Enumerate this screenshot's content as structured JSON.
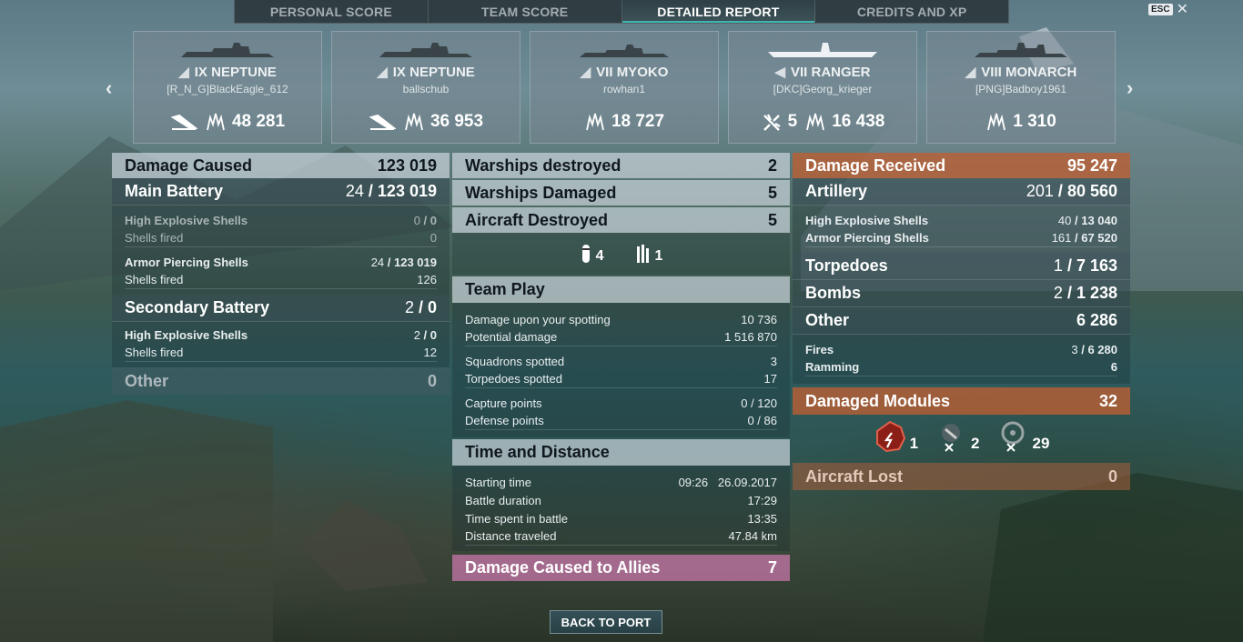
{
  "tabs": [
    {
      "label": "PERSONAL SCORE"
    },
    {
      "label": "TEAM SCORE"
    },
    {
      "label": "DETAILED REPORT"
    },
    {
      "label": "CREDITS AND XP"
    }
  ],
  "esc_label": "ESC",
  "ships": [
    {
      "tier": "IX",
      "name": "NEPTUNE",
      "player": "[R_N_G]BlackEagle_612",
      "kills": null,
      "damage": "48 281",
      "kill_icon": "sunk-ship-icon"
    },
    {
      "tier": "IX",
      "name": "NEPTUNE",
      "player": "ballschub",
      "kills": null,
      "damage": "36 953",
      "kill_icon": "sunk-ship-icon"
    },
    {
      "tier": "VII",
      "name": "MYOKO",
      "player": "rowhan1",
      "kills": null,
      "damage": "18 727"
    },
    {
      "tier": "VII",
      "name": "RANGER",
      "player": "[DKC]Georg_krieger",
      "kills": "5",
      "damage": "16 438",
      "kill_icon": "aircraft-downed-icon"
    },
    {
      "tier": "VIII",
      "name": "MONARCH",
      "player": "[PNG]Badboy1961",
      "kills": null,
      "damage": "1 310"
    }
  ],
  "left": {
    "damage_caused": {
      "label": "Damage Caused",
      "value": "123 019"
    },
    "main_battery": {
      "label": "Main Battery",
      "hits": "24",
      "value": "123 019"
    },
    "he": {
      "label": "High Explosive Shells",
      "hits": "0",
      "value": "0"
    },
    "he_fired": {
      "label": "Shells fired",
      "value": "0"
    },
    "ap": {
      "label": "Armor Piercing Shells",
      "hits": "24",
      "value": "123 019"
    },
    "ap_fired": {
      "label": "Shells fired",
      "value": "126"
    },
    "secondary": {
      "label": "Secondary Battery",
      "hits": "2",
      "value": "0"
    },
    "sec_he": {
      "label": "High Explosive Shells",
      "hits": "2",
      "value": "0"
    },
    "sec_fired": {
      "label": "Shells fired",
      "value": "12"
    },
    "other": {
      "label": "Other",
      "value": "0"
    }
  },
  "middle": {
    "warships_destroyed": {
      "label": "Warships destroyed",
      "value": "2"
    },
    "warships_damaged": {
      "label": "Warships Damaged",
      "value": "5"
    },
    "aircraft_destroyed": {
      "label": "Aircraft Destroyed",
      "value": "5"
    },
    "aircraft_icons": [
      {
        "icon": "bomber-icon",
        "value": "4"
      },
      {
        "icon": "torpedo-bomber-icon",
        "value": "1"
      }
    ],
    "team_play": {
      "label": "Team Play",
      "rows": [
        {
          "label": "Damage upon your spotting",
          "value": "10 736"
        },
        {
          "label": "Potential damage",
          "value": "1 516 870"
        },
        {
          "label": "Squadrons spotted",
          "value": "3"
        },
        {
          "label": "Torpedoes spotted",
          "value": "17"
        },
        {
          "label": "Capture points",
          "value": "0 / 120"
        },
        {
          "label": "Defense points",
          "value": "0 / 86"
        }
      ]
    },
    "time_distance": {
      "label": "Time and Distance",
      "rows": [
        {
          "label": "Starting time",
          "value": "09:26   26.09.2017"
        },
        {
          "label": "Battle duration",
          "value": "17:29"
        },
        {
          "label": "Time spent in battle",
          "value": "13:35"
        },
        {
          "label": "Distance traveled",
          "value": "47.84 km"
        }
      ]
    },
    "allies": {
      "label": "Damage Caused to Allies",
      "value": "7"
    }
  },
  "right": {
    "damage_received": {
      "label": "Damage Received",
      "value": "95 247"
    },
    "artillery": {
      "label": "Artillery",
      "hits": "201",
      "value": "80 560"
    },
    "he": {
      "label": "High Explosive Shells",
      "hits": "40",
      "value": "13 040"
    },
    "ap": {
      "label": "Armor Piercing Shells",
      "hits": "161",
      "value": "67 520"
    },
    "torpedoes": {
      "label": "Torpedoes",
      "hits": "1",
      "value": "7 163"
    },
    "bombs": {
      "label": "Bombs",
      "hits": "2",
      "value": "1 238"
    },
    "other": {
      "label": "Other",
      "value": "6 286"
    },
    "fires": {
      "label": "Fires",
      "hits": "3",
      "value": "6 280"
    },
    "ramming": {
      "label": "Ramming",
      "value": "6"
    },
    "modules": {
      "label": "Damaged Modules",
      "value": "32"
    },
    "module_icons": [
      {
        "icon": "engine-damaged-icon",
        "value": "1"
      },
      {
        "icon": "turret-damaged-icon",
        "value": "2"
      },
      {
        "icon": "steering-damaged-icon",
        "value": "29"
      }
    ],
    "aircraft_lost": {
      "label": "Aircraft Lost",
      "value": "0"
    }
  },
  "back_button": "BACK TO PORT",
  "colors": {
    "accent": "#3fb4b0",
    "received": "#be5f32",
    "allies": "#cd78af"
  }
}
